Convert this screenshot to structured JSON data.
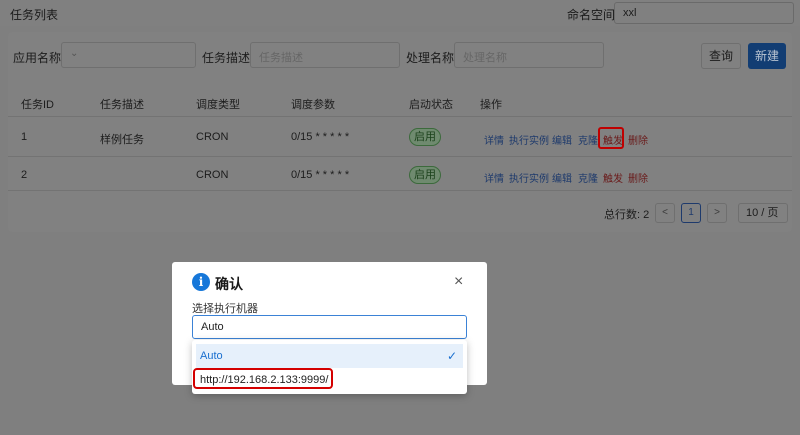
{
  "header": {
    "title": "任务列表",
    "namespace_label": "命名空间:",
    "namespace_value": "xxl"
  },
  "filters": {
    "app_name_label": "应用名称",
    "app_name_value": "",
    "task_desc_label": "任务描述",
    "task_desc_placeholder": "任务描述",
    "processor_label": "处理名称",
    "processor_placeholder": "处理名称",
    "query_label": "查询",
    "new_label": "新建"
  },
  "table": {
    "columns": [
      "任务ID",
      "任务描述",
      "调度类型",
      "调度参数",
      "启动状态",
      "操作"
    ],
    "rows": [
      {
        "id": "1",
        "desc": "样例任务",
        "type": "CRON",
        "param": "0/15 * * * * *",
        "status": "启用"
      },
      {
        "id": "2",
        "desc": "",
        "type": "CRON",
        "param": "0/15 * * * * *",
        "status": "启用"
      }
    ],
    "actions": [
      "详情",
      "执行实例",
      "编辑",
      "克隆",
      "触发",
      "删除"
    ]
  },
  "pagination": {
    "total_label": "总行数: 2",
    "prev": "<",
    "page": "1",
    "next": ">",
    "page_size": "10 / 页"
  },
  "modal": {
    "icon": "info-icon",
    "title": "确认",
    "close": "×",
    "field_label": "选择执行机器",
    "selected": "Auto",
    "options": [
      "Auto",
      "http://192.168.2.133:9999/"
    ]
  },
  "colors": {
    "primary": "#1677d9",
    "highlight": "#d40000"
  }
}
